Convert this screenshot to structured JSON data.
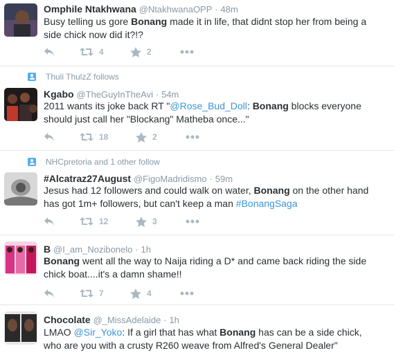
{
  "colors": {
    "link": "#3b94d9",
    "muted": "#8899a6",
    "action": "#aab8c2",
    "context_icon": "#55acee"
  },
  "tweets": [
    {
      "fullname": "Omphile Ntakhwana",
      "username": "@NtakhwanaOPP",
      "sep": "·",
      "time": "48m",
      "text_before": "Busy telling us gore ",
      "bold": "Bonang",
      "text_after": " made it in life, that didnt stop her from being a side chick now did it?!?",
      "retweets": "4",
      "favorites": "2",
      "icons": [
        "reply-icon",
        "retweet-icon",
        "favorite-star-icon",
        "more-dots-icon"
      ]
    },
    {
      "context": "Thuli ThulzZ follows",
      "fullname": "Kgabo",
      "username": "@TheGuyInTheAvi",
      "sep": "·",
      "time": "54m",
      "text_before": "2011 wants its joke back RT \"",
      "mention": "@Rose_Bud_Doll",
      "text_mid": ": ",
      "bold": "Bonang",
      "text_after": " blocks everyone should just call her \"Blockang\" Matheba once...\"",
      "retweets": "18",
      "favorites": "2"
    },
    {
      "context": "NHCpretoria and 1 other follow",
      "fullname": "#Alcatraz27August",
      "username": "@FigoMadridismo",
      "sep": "·",
      "time": "59m",
      "text_before": "Jesus had 12 followers and could walk on water, ",
      "bold": "Bonang",
      "text_after": " on the other hand has got 1m+ followers, but can't keep a man ",
      "hashtag": "#BonangSaga",
      "retweets": "12",
      "favorites": "3"
    },
    {
      "fullname": "B",
      "username": "@I_am_Nozibonelo",
      "sep": "·",
      "time": "1h",
      "bold": "Bonang",
      "text_after": " went all the way to Naija riding a D* and came back riding the side chick boat....it's a damn shame!!",
      "retweets": "7",
      "favorites": "4"
    },
    {
      "fullname": "Chocolate",
      "username": "@_MissAdelaide",
      "sep": "·",
      "time": "1h",
      "text_before": "LMAO ",
      "mention": "@Sir_Yoko",
      "text_mid": ": If a girl that has what ",
      "bold": "Bonang",
      "text_after": " has can be a side chick, who are you with a crusty R260 weave from Alfred's General Dealer\""
    }
  ]
}
